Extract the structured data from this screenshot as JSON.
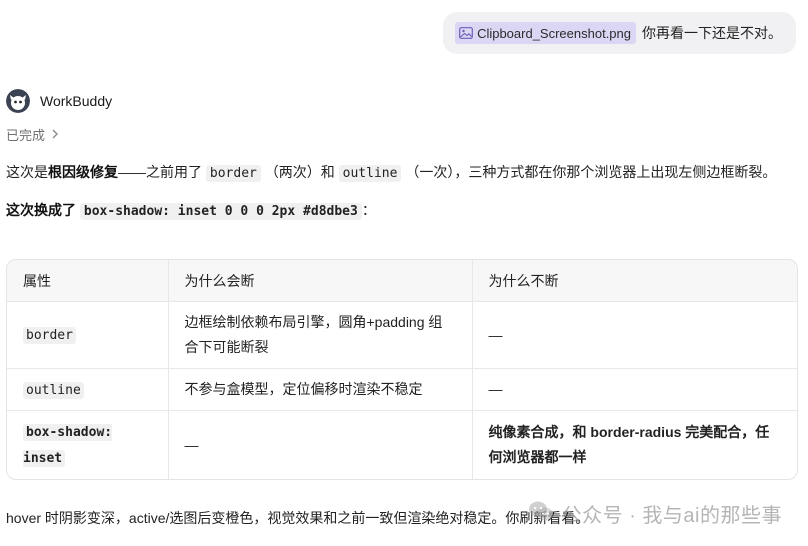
{
  "user_message": {
    "attachment_name": "Clipboard_Screenshot.png",
    "attachment_icon": "image-icon",
    "text": "你再看一下还是不对。"
  },
  "assistant": {
    "name": "WorkBuddy",
    "status": "已完成"
  },
  "para1": {
    "t1": "这次是",
    "b1": "根因级修复",
    "t2": "——之前用了 ",
    "c1": "border",
    "t3": " （两次）和 ",
    "c2": "outline",
    "t4": " （一次），三种方式都在你那个浏览器上出现左侧边框断裂。"
  },
  "para2": {
    "b1": "这次换成了 ",
    "c1": "box-shadow: inset 0 0 0 2px #d8dbe3",
    "t1": "："
  },
  "table": {
    "headers": [
      "属性",
      "为什么会断",
      "为什么不断"
    ],
    "rows": [
      {
        "prop": "border",
        "why_break": "边框绘制依赖布局引擎，圆角+padding 组合下可能断裂",
        "why_not": "—"
      },
      {
        "prop": "outline",
        "why_break": "不参与盒模型，定位偏移时渲染不稳定",
        "why_not": "—"
      },
      {
        "prop": "box-shadow: inset",
        "why_break": "—",
        "why_not": "纯像素合成，和 border-radius 完美配合，任何浏览器都一样"
      }
    ]
  },
  "para3": "hover 时阴影变深，active/选图后变橙色，视觉效果和之前一致但渲染绝对稳定。你刷新看看。",
  "watermark": "公众号 · 我与ai的那些事",
  "colors": {
    "chip_bg": "#dcd6f5",
    "bubble_bg": "#f1f1f3",
    "table_header_bg": "#f7f7f7"
  }
}
